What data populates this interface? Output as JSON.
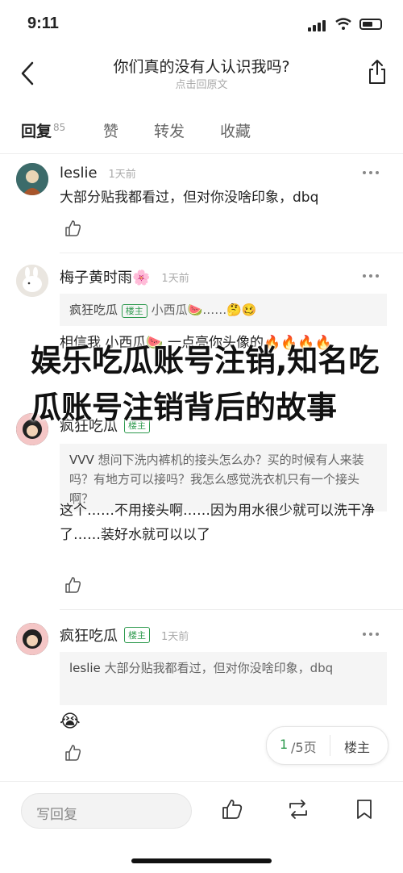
{
  "status": {
    "time": "9:11"
  },
  "nav": {
    "title": "你们真的没有人认识我吗?",
    "subtitle": "点击回原文"
  },
  "tabs": [
    {
      "label": "回复",
      "count": "85"
    },
    {
      "label": "赞"
    },
    {
      "label": "转发"
    },
    {
      "label": "收藏"
    }
  ],
  "comments": [
    {
      "name": "leslie",
      "time": "1天前",
      "text": "大部分贴我都看过，但对你没啥印象，dbq"
    },
    {
      "name": "梅子黄时雨🌸",
      "time": "1天前",
      "quote_name": "疯狂吃瓜",
      "quote_badge": "楼主",
      "quote_text": "小西瓜🍉……🤔🥴",
      "text": "相信我 小西瓜🍉 一点亮你头像的🔥🔥🔥🔥"
    },
    {
      "name": "疯狂吃瓜",
      "badge": "楼主",
      "quote_name": "VVV",
      "quote_text": "想问下洗内裤机的接头怎么办？买的时候有人来装吗？有地方可以接吗？我怎么感觉洗衣机只有一个接头啊？",
      "text": "这个……不用接头啊……因为用水很少就可以洗干净了……装好水就可以以了"
    },
    {
      "name": "疯狂吃瓜",
      "badge": "楼主",
      "time": "1天前",
      "quote_name": "leslie",
      "quote_text": "大部分贴我都看过，但对你没啥印象，dbq",
      "text": "😭"
    }
  ],
  "overlay_text": "娱乐吃瓜账号注销,知名吃瓜账号注销背后的故事",
  "pager": {
    "current": "1",
    "total": "/5页",
    "op": "楼主"
  },
  "bottom": {
    "reply_placeholder": "写回复"
  },
  "colors": {
    "accent": "#2e9a4e",
    "overlay": "#111111"
  },
  "icons": [
    "back-icon",
    "share-icon",
    "more-icon",
    "like-icon",
    "thumbs-up-icon",
    "repost-icon",
    "bookmark-icon"
  ]
}
